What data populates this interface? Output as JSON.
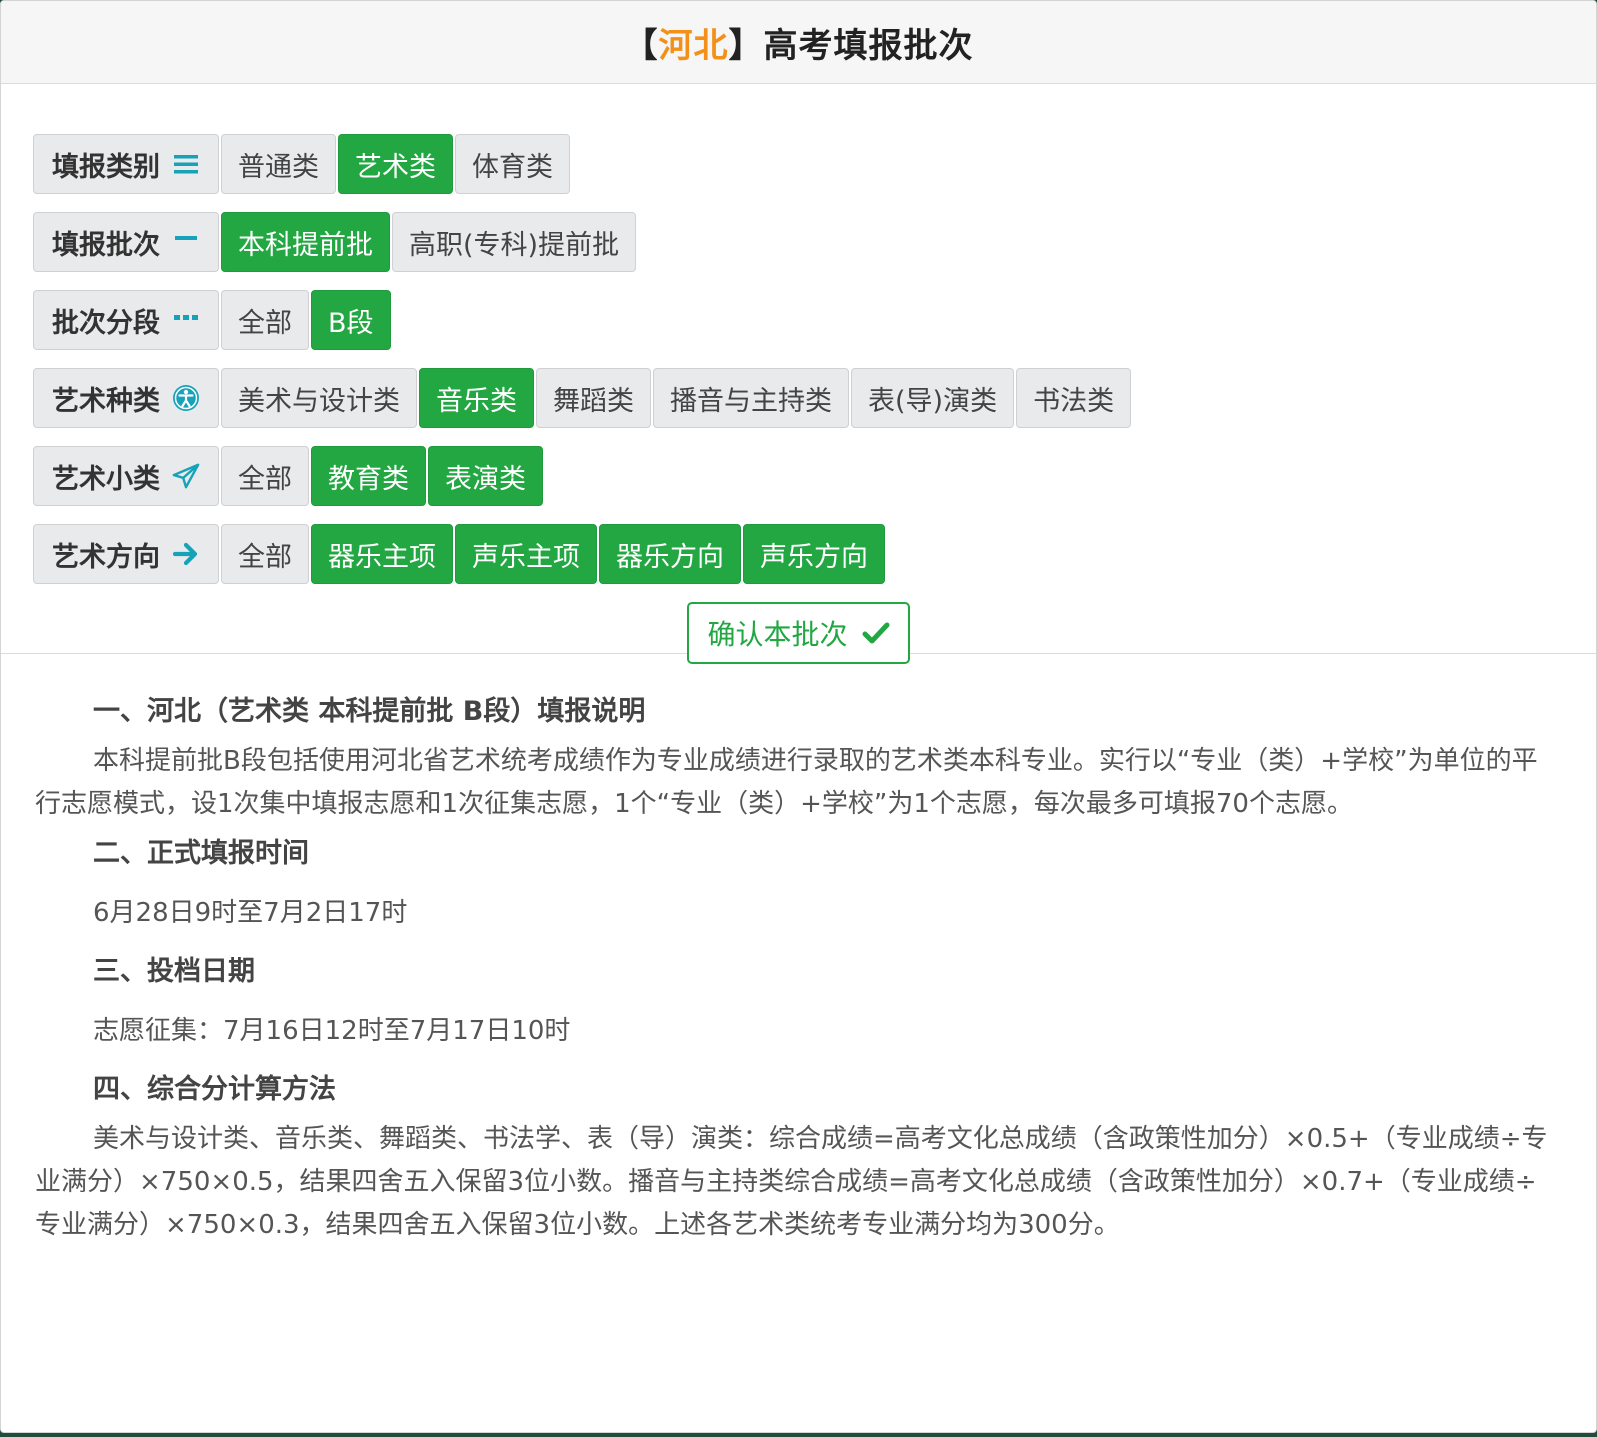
{
  "header": {
    "bracket_open": "【",
    "province": "河北",
    "bracket_close": "】",
    "title": "高考填报批次"
  },
  "rows": [
    {
      "label": "填报类别",
      "icon": "list-icon",
      "options": [
        {
          "text": "普通类",
          "selected": false
        },
        {
          "text": "艺术类",
          "selected": true
        },
        {
          "text": "体育类",
          "selected": false
        }
      ]
    },
    {
      "label": "填报批次",
      "icon": "minus-icon",
      "options": [
        {
          "text": "本科提前批",
          "selected": true
        },
        {
          "text": "高职(专科)提前批",
          "selected": false
        }
      ]
    },
    {
      "label": "批次分段",
      "icon": "ellipsis-icon",
      "options": [
        {
          "text": "全部",
          "selected": false
        },
        {
          "text": "B段",
          "selected": true
        }
      ]
    },
    {
      "label": "艺术种类",
      "icon": "accessibility-icon",
      "options": [
        {
          "text": "美术与设计类",
          "selected": false
        },
        {
          "text": "音乐类",
          "selected": true
        },
        {
          "text": "舞蹈类",
          "selected": false
        },
        {
          "text": "播音与主持类",
          "selected": false
        },
        {
          "text": "表(导)演类",
          "selected": false
        },
        {
          "text": "书法类",
          "selected": false
        }
      ]
    },
    {
      "label": "艺术小类",
      "icon": "paper-plane-icon",
      "options": [
        {
          "text": "全部",
          "selected": false
        },
        {
          "text": "教育类",
          "selected": true
        },
        {
          "text": "表演类",
          "selected": true
        }
      ]
    },
    {
      "label": "艺术方向",
      "icon": "arrow-right-icon",
      "options": [
        {
          "text": "全部",
          "selected": false
        },
        {
          "text": "器乐主项",
          "selected": true
        },
        {
          "text": "声乐主项",
          "selected": true
        },
        {
          "text": "器乐方向",
          "selected": true
        },
        {
          "text": "声乐方向",
          "selected": true
        }
      ]
    }
  ],
  "confirm": {
    "label": "确认本批次",
    "icon": "check-icon"
  },
  "info": {
    "s1_title": "一、河北（艺术类  本科提前批  B段）填报说明",
    "s1_text": "本科提前批B段包括使用河北省艺术统考成绩作为专业成绩进行录取的艺术类本科专业。实行以“专业（类）+学校”为单位的平行志愿模式，设1次集中填报志愿和1次征集志愿，1个“专业（类）+学校”为1个志愿，每次最多可填报70个志愿。",
    "s2_title": "二、正式填报时间",
    "s2_text": "6月28日9时至7月2日17时",
    "s3_title": "三、投档日期",
    "s3_text": "志愿征集：7月16日12时至7月17日10时",
    "s4_title": "四、综合分计算方法",
    "s4_text": "美术与设计类、音乐类、舞蹈类、书法学、表（导）演类：综合成绩=高考文化总成绩（含政策性加分）×0.5+（专业成绩÷专业满分）×750×0.5，结果四舍五入保留3位小数。播音与主持类综合成绩=高考文化总成绩（含政策性加分）×0.7+（专业成绩÷专业满分）×750×0.3，结果四舍五入保留3位小数。上述各艺术类统考专业满分均为300分。"
  },
  "colors": {
    "accent_green": "#23a743",
    "province_orange": "#f39019",
    "icon_teal": "#16a2b8"
  }
}
